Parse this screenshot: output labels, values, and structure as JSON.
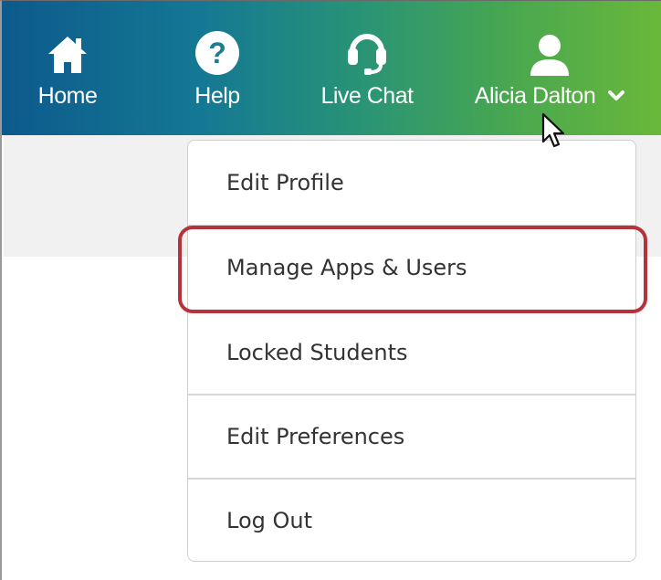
{
  "topnav": {
    "items": [
      {
        "label": "Home",
        "icon": "home-icon"
      },
      {
        "label": "Help",
        "icon": "help-icon"
      },
      {
        "label": "Live Chat",
        "icon": "headset-icon"
      }
    ],
    "user": {
      "name": "Alicia Dalton",
      "icon": "user-icon",
      "caret": "chevron-down-icon"
    }
  },
  "dropdown": {
    "items": [
      {
        "label": "Edit Profile"
      },
      {
        "label": "Manage Apps & Users",
        "highlighted": true
      },
      {
        "label": "Locked Students"
      },
      {
        "label": "Edit Preferences"
      },
      {
        "label": "Log Out"
      }
    ]
  },
  "colors": {
    "gradient_start": "#0d5a8c",
    "gradient_end": "#6ab83a",
    "highlight_border": "#b5343c",
    "menu_text": "#333333"
  }
}
